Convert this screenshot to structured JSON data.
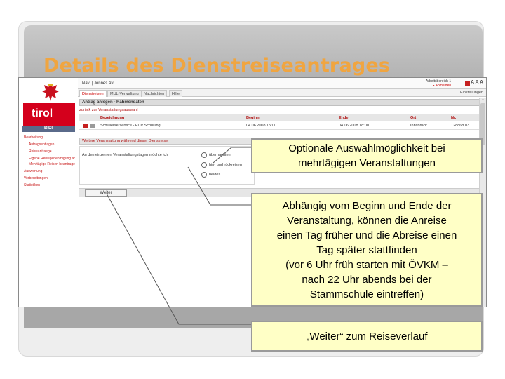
{
  "slide": {
    "title": "Details des Dienstreiseantrages"
  },
  "app": {
    "logo_text": "tirol",
    "sidebar_header": "BIDI",
    "sidebar_items": [
      {
        "label": "Bearbeitung",
        "level": 0
      },
      {
        "label": "Antragsentlagen",
        "level": 1
      },
      {
        "label": "Reiseantraege",
        "level": 1
      },
      {
        "label": "Eigene Reisegenehmigung ändern",
        "level": 1
      },
      {
        "label": "Mehrtägige Reisen beantragen",
        "level": 1
      },
      {
        "label": "Auswertung",
        "level": 0
      },
      {
        "label": "Vorbereitungen",
        "level": 0
      },
      {
        "label": "Statistiken",
        "level": 0
      }
    ],
    "user": "Navi | Jonnes Avi",
    "top_right": {
      "line1": "Arbeitsbereich 1",
      "line2": "▸ Abmelden",
      "font_size_label": "A A A"
    },
    "tabs": [
      {
        "label": "Dienstreisen",
        "active": true
      },
      {
        "label": "MUL-Verwaltung",
        "active": false
      },
      {
        "label": "Nachrichten",
        "active": false
      },
      {
        "label": "Hilfe",
        "active": false
      }
    ],
    "settings_label": "Einstellungen",
    "section_title": "Antrag anlegen - Rahmendaten",
    "back_link": "zurück zur Veranstaltungsauswahl",
    "table": {
      "headers": [
        "Bezeichnung",
        "Beginn",
        "Ende",
        "Ort",
        "Nr."
      ],
      "rows": [
        {
          "name": "Schullerserservice - EDV Schulung",
          "begin": "04.06.2008 15:00",
          "end": "04.06.2008 18:00",
          "place": "Innsbruck",
          "nr": "128868.03"
        }
      ]
    },
    "subsection_title": "Weitere Veranstaltung während dieser Dienstreise",
    "question": "An den einzelnen Veranstaltungstagen möchte ich",
    "radio_options": [
      "übernachten",
      "hin- und rückreisen",
      "beides"
    ],
    "weiter_label": "Weiter"
  },
  "callouts": [
    {
      "text": "Optionale Auswahlmöglichkeit bei\nmehrtägigen Veranstaltungen"
    },
    {
      "text": "Abhängig vom Beginn und Ende der\nVeranstaltung, können die Anreise\neinen Tag früher und die Abreise einen\nTag später stattfinden\n(vor 6 Uhr früh starten mit ÖVKM –\nnach 22 Uhr abends bei der\nStammschule eintreffen)"
    },
    {
      "text": "„Weiter“ zum Reiseverlauf"
    }
  ]
}
